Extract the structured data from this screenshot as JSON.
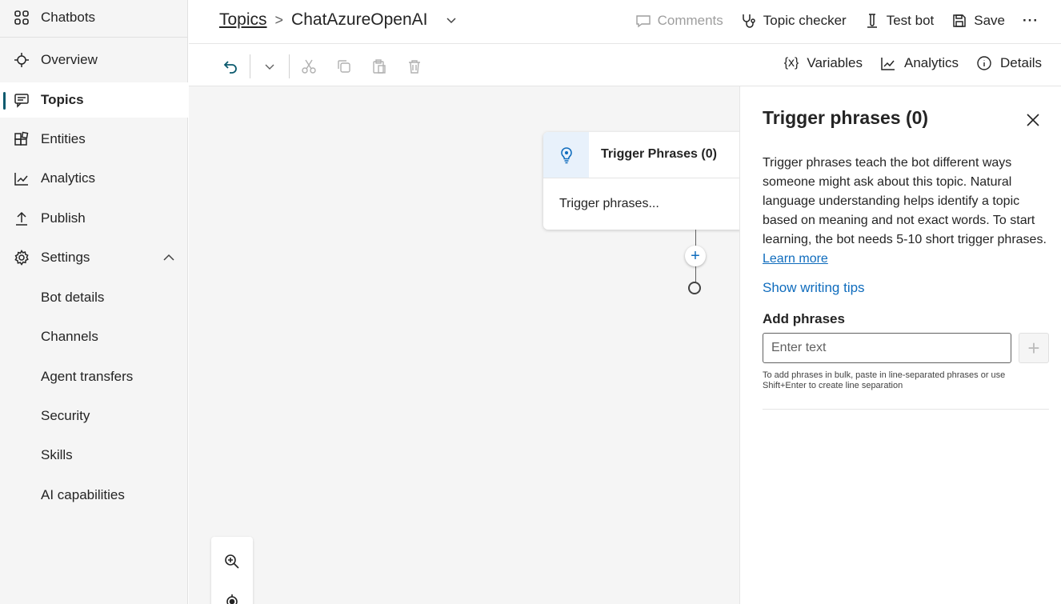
{
  "sidebar": {
    "items": [
      {
        "label": "Chatbots",
        "icon": "chatbots-grid-icon"
      },
      {
        "label": "Overview",
        "icon": "overview-icon"
      },
      {
        "label": "Topics",
        "icon": "topics-chat-icon",
        "active": true
      },
      {
        "label": "Entities",
        "icon": "entities-icon"
      },
      {
        "label": "Analytics",
        "icon": "analytics-chart-icon"
      },
      {
        "label": "Publish",
        "icon": "publish-upload-icon"
      },
      {
        "label": "Settings",
        "icon": "settings-gear-icon",
        "expanded": true
      },
      {
        "label": "Bot details"
      },
      {
        "label": "Channels"
      },
      {
        "label": "Agent transfers"
      },
      {
        "label": "Security"
      },
      {
        "label": "Skills"
      },
      {
        "label": "AI capabilities"
      }
    ]
  },
  "header": {
    "breadcrumb_root": "Topics",
    "breadcrumb_current": "ChatAzureOpenAI",
    "actions": {
      "comments": "Comments",
      "topic_checker": "Topic checker",
      "test_bot": "Test bot",
      "save": "Save",
      "more": "···"
    }
  },
  "toolbar": {
    "variables": "Variables",
    "variables_glyph": "{x}",
    "analytics": "Analytics",
    "details": "Details"
  },
  "canvas": {
    "node_title": "Trigger Phrases (0)",
    "node_body": "Trigger phrases...",
    "add_node_symbol": "+"
  },
  "panel": {
    "title": "Trigger phrases (0)",
    "description": "Trigger phrases teach the bot different ways someone might ask about this topic. Natural language understanding helps identify a topic based on meaning and not exact words. To start learning, the bot needs 5-10 short trigger phrases.",
    "learn_more": "Learn more",
    "writing_tips": "Show writing tips",
    "add_label": "Add phrases",
    "input_placeholder": "Enter text",
    "add_symbol": "+",
    "hint": "To add phrases in bulk, paste in line-separated phrases or use Shift+Enter to create line separation"
  },
  "colors": {
    "accent": "#0f6cbd",
    "active_marker": "#0b5a6e",
    "sidebar_bg": "#f5f5f5",
    "canvas_bg": "#f5f5f5"
  }
}
